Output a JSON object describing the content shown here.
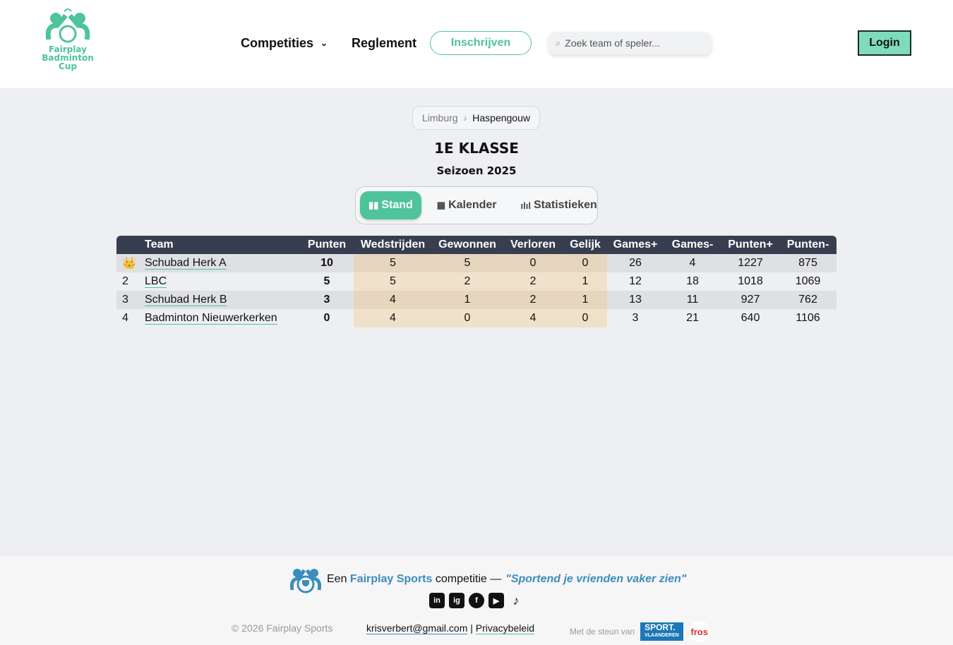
{
  "header": {
    "logo_text": [
      "Fairplay",
      "Badminton",
      "Cup"
    ],
    "nav": {
      "competities": "Competities",
      "reglement": "Reglement",
      "inschrijven": "Inschrijven"
    },
    "search_placeholder": "Zoek team of speler...",
    "login": "Login"
  },
  "breadcrumb": [
    "Limburg",
    "Haspengouw"
  ],
  "title": "1E KLASSE",
  "season": "Seizoen 2025",
  "tabs": [
    {
      "label": "Stand",
      "icon": "bar-chart-icon",
      "active": true
    },
    {
      "label": "Kalender",
      "icon": "calendar-icon"
    },
    {
      "label": "Statistieken",
      "icon": "stats-icon"
    }
  ],
  "table": {
    "headers": [
      "",
      "Team",
      "Punten",
      "Wedstrijden",
      "Gewonnen",
      "Verloren",
      "Gelijk",
      "Games+",
      "Games-",
      "Punten+",
      "Punten-"
    ],
    "rows": [
      {
        "rank": "👑",
        "team": "Schubad Herk A",
        "punten": "10",
        "wed": "5",
        "gew": "5",
        "ver": "0",
        "gel": "0",
        "gp": "26",
        "gm": "4",
        "pp": "1227",
        "pm": "875"
      },
      {
        "rank": "2",
        "team": "LBC",
        "punten": "5",
        "wed": "5",
        "gew": "2",
        "ver": "2",
        "gel": "1",
        "gp": "12",
        "gm": "18",
        "pp": "1018",
        "pm": "1069"
      },
      {
        "rank": "3",
        "team": "Schubad Herk B",
        "punten": "3",
        "wed": "4",
        "gew": "1",
        "ver": "2",
        "gel": "1",
        "gp": "13",
        "gm": "11",
        "pp": "927",
        "pm": "762"
      },
      {
        "rank": "4",
        "team": "Badminton Nieuwerkerken",
        "punten": "0",
        "wed": "4",
        "gew": "0",
        "ver": "4",
        "gel": "0",
        "gp": "3",
        "gm": "21",
        "pp": "640",
        "pm": "1106"
      }
    ]
  },
  "footer": {
    "een": "Een",
    "brand": "Fairplay Sports",
    "competitie": "competitie —",
    "quote": "\"Sportend je vrienden vaker zien\"",
    "social": [
      "in",
      "ig",
      "f",
      "▶",
      "♪"
    ],
    "copyright": "© 2026 Fairplay Sports",
    "email": "krisverbert@gmail.com",
    "sep": "|",
    "privacy": "Privacybeleid",
    "steun": "Met de steun van",
    "sport": "SPORT.",
    "vlaanderen": "VLAANDEREN",
    "fros": "fros"
  }
}
